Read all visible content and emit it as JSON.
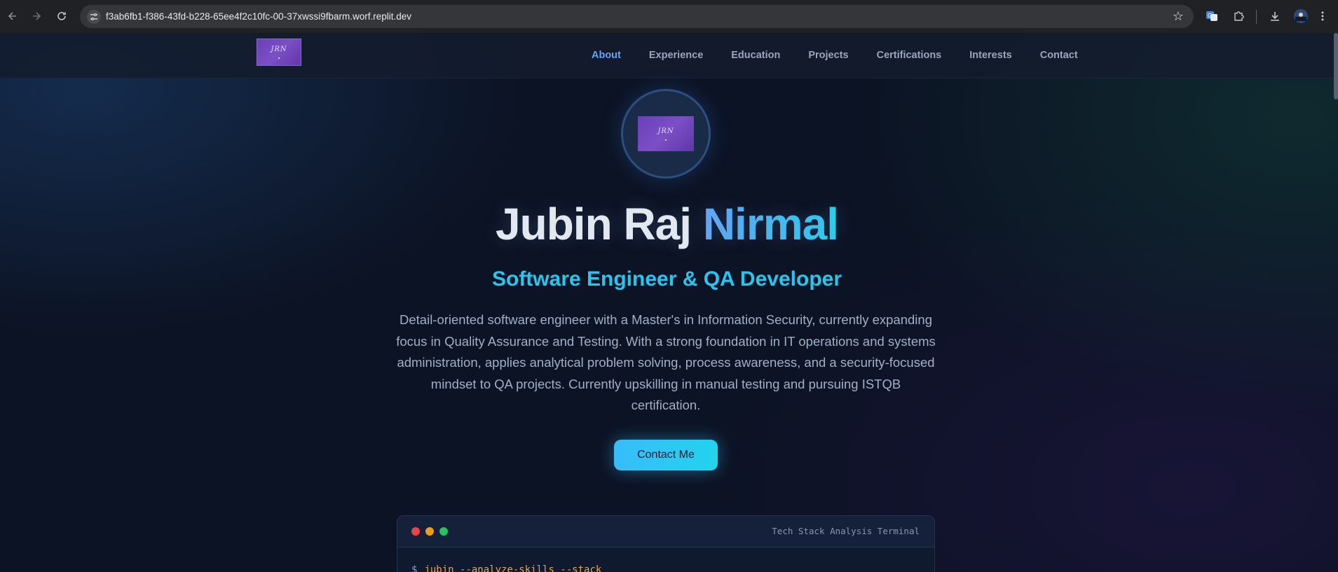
{
  "browser": {
    "url": "f3ab6fb1-f386-43fd-b228-65ee4f2c10fc-00-37xwssi9fbarm.worf.replit.dev"
  },
  "nav": {
    "logo_text": "JRN",
    "items": [
      {
        "label": "About",
        "active": true
      },
      {
        "label": "Experience",
        "active": false
      },
      {
        "label": "Education",
        "active": false
      },
      {
        "label": "Projects",
        "active": false
      },
      {
        "label": "Certifications",
        "active": false
      },
      {
        "label": "Interests",
        "active": false
      },
      {
        "label": "Contact",
        "active": false
      }
    ]
  },
  "hero": {
    "avatar_text": "JRN",
    "name_first": "Jubin Raj",
    "name_last": "Nirmal",
    "role": "Software Engineer & QA Developer",
    "bio": "Detail-oriented software engineer with a Master's in Information Security, currently expanding focus in Quality Assurance and Testing. With a strong foundation in IT operations and systems administration, applies analytical problem solving, process awareness, and a security-focused mindset to QA projects. Currently upskilling in manual testing and pursuing ISTQB certification.",
    "cta_label": "Contact Me"
  },
  "terminal": {
    "title": "Tech Stack Analysis Terminal",
    "prompt": "$",
    "command": "jubin --analyze-skills --stack"
  },
  "colors": {
    "accent_blue": "#60a5fa",
    "accent_cyan": "#22d3ee",
    "background": "#0c1324",
    "dot_red": "#ef4444",
    "dot_yellow": "#f59e0b",
    "dot_green": "#22c55e"
  }
}
